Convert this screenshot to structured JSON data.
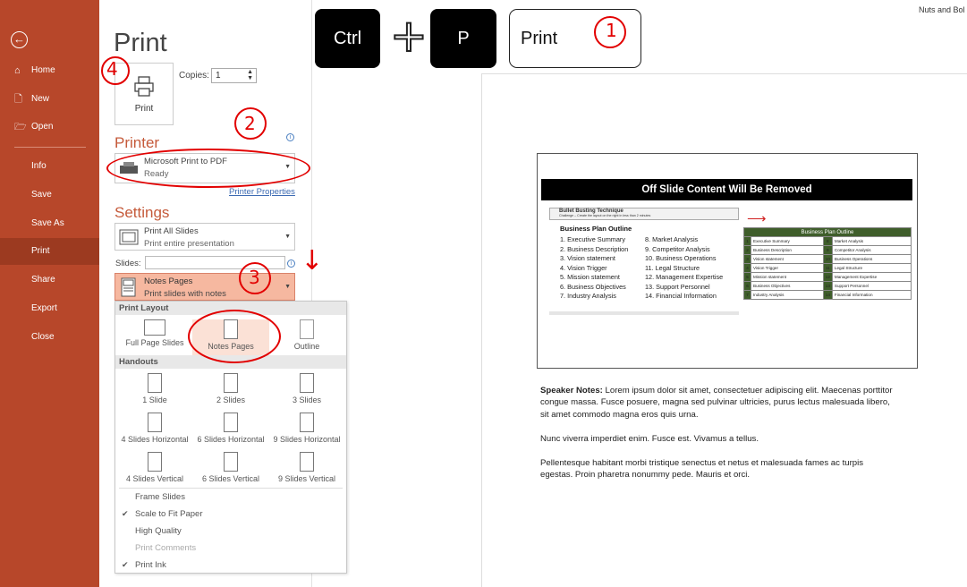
{
  "window_title_right": "Nuts and Bol",
  "sidebar": {
    "back_label": "←",
    "items": [
      {
        "label": "Home",
        "icon": "⌂"
      },
      {
        "label": "New",
        "icon": "🗋"
      },
      {
        "label": "Open",
        "icon": "🗁"
      },
      {
        "label": "Info"
      },
      {
        "label": "Save"
      },
      {
        "label": "Save As"
      },
      {
        "label": "Print"
      },
      {
        "label": "Share"
      },
      {
        "label": "Export"
      },
      {
        "label": "Close"
      }
    ]
  },
  "print": {
    "title": "Print",
    "copies_label": "Copies:",
    "copies_value": "1",
    "print_button": "Print",
    "printer_section": "Printer",
    "printer_name": "Microsoft Print to PDF",
    "printer_status": "Ready",
    "printer_properties": "Printer Properties",
    "settings_section": "Settings",
    "slides_dropdown": {
      "title": "Print All Slides",
      "sub": "Print entire presentation"
    },
    "slides_label": "Slides:",
    "layout_dropdown": {
      "title": "Notes Pages",
      "sub": "Print slides with notes"
    }
  },
  "menu": {
    "print_layout_header": "Print Layout",
    "layouts": [
      "Full Page Slides",
      "Notes Pages",
      "Outline"
    ],
    "handouts_header": "Handouts",
    "handouts": [
      "1 Slide",
      "2 Slides",
      "3 Slides",
      "4 Slides Horizontal",
      "6 Slides Horizontal",
      "9 Slides Horizontal",
      "4 Slides Vertical",
      "6 Slides Vertical",
      "9 Slides Vertical"
    ],
    "options": [
      {
        "label": "Frame Slides",
        "checked": false
      },
      {
        "label": "Scale to Fit Paper",
        "checked": true
      },
      {
        "label": "High Quality",
        "checked": false
      },
      {
        "label": "Print Comments",
        "checked": false
      },
      {
        "label": "Print Ink",
        "checked": true
      }
    ]
  },
  "shortcut": {
    "key1": "Ctrl",
    "plus": "+",
    "key2": "P",
    "box": "Print"
  },
  "annotations": {
    "one": "1",
    "two": "2",
    "three": "3",
    "four": "4"
  },
  "slide": {
    "banner": "Off Slide Content Will Be Removed",
    "subtitle": "Bullet Busting Technique",
    "subnote": "Challenge – Create the layout on the right in less than 2 minutes",
    "outline_title": "Business Plan Outline",
    "items": [
      "Executive Summary",
      "Business Description",
      "Vision statement",
      "Vision Trigger",
      "Mission statement",
      "Business Objectives",
      "Industry Analysis",
      "Market Analysis",
      "Competitor Analysis",
      "Business Operations",
      "Legal Structure",
      "Management Expertise",
      "Support Personnel",
      "Financial Information"
    ],
    "table_header": "Business Plan Outline"
  },
  "notes": {
    "label": "Speaker Notes:",
    "p1": " Lorem ipsum dolor sit amet, consectetuer adipiscing elit. Maecenas porttitor congue massa. Fusce posuere, magna sed pulvinar ultricies, purus lectus malesuada libero, sit amet commodo magna eros quis urna.",
    "p2": "Nunc viverra imperdiet enim. Fusce est. Vivamus a tellus.",
    "p3": "Pellentesque habitant morbi tristique senectus et netus et malesuada fames ac turpis egestas. Proin pharetra nonummy pede. Mauris et orci."
  },
  "colors": {
    "sidebar": "#b7472a",
    "accent": "#c55a3a",
    "annotation": "#e20000",
    "table_num": "#3f5e2b"
  }
}
